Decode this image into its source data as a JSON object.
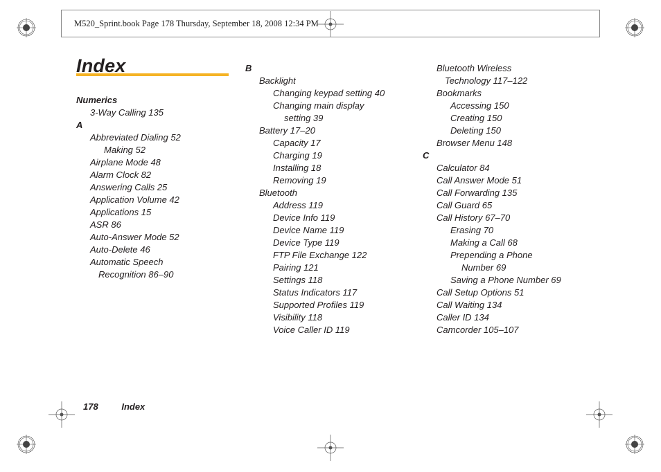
{
  "crop_header": "M520_Sprint.book  Page 178  Thursday, September 18, 2008  12:34 PM",
  "title": "Index",
  "footer": {
    "page": "178",
    "label": "Index"
  },
  "c1": {
    "hNumerics": "Numerics",
    "e3way": "3-Way Calling 135",
    "hA": "A",
    "abbrev": "Abbreviated Dialing 52",
    "abbrevMaking": "Making 52",
    "airplane": "Airplane Mode 48",
    "alarm": "Alarm Clock 82",
    "answering": "Answering Calls 25",
    "appvol": "Application Volume 42",
    "apps": "Applications 15",
    "asr": "ASR 86",
    "autoans": "Auto-Answer Mode 52",
    "autodel": "Auto-Delete 46",
    "autospeech1": "Automatic Speech",
    "autospeech2": "Recognition 86–90"
  },
  "c2": {
    "hB": "B",
    "backlight": "Backlight",
    "blKeypad": "Changing keypad setting 40",
    "blMain1": "Changing main display",
    "blMain2": "setting 39",
    "battery": "Battery 17–20",
    "batCap": "Capacity 17",
    "batChg": "Charging 19",
    "batInst": "Installing 18",
    "batRem": "Removing 19",
    "bluetooth": "Bluetooth",
    "btAddr": "Address 119",
    "btDevInfo": "Device Info 119",
    "btDevName": "Device Name 119",
    "btDevType": "Device Type 119",
    "btFtp": "FTP File Exchange 122",
    "btPair": "Pairing 121",
    "btSet": "Settings 118",
    "btStat": "Status Indicators 117",
    "btSup": "Supported Profiles 119",
    "btVis": "Visibility 118",
    "btVcid": "Voice Caller ID 119"
  },
  "c3": {
    "btw1": "Bluetooth Wireless",
    "btw2": "Technology 117–122",
    "bookmarks": "Bookmarks",
    "bmAccess": "Accessing 150",
    "bmCreate": "Creating 150",
    "bmDelete": "Deleting 150",
    "browser": "Browser Menu 148",
    "hC": "C",
    "calc": "Calculator 84",
    "callAns": "Call Answer Mode 51",
    "callFwd": "Call Forwarding 135",
    "callGuard": "Call Guard 65",
    "callHist": "Call History 67–70",
    "chErase": "Erasing 70",
    "chMake": "Making a Call 68",
    "chPre1": "Prepending a Phone",
    "chPre2": "Number 69",
    "chSave": "Saving a Phone Number 69",
    "callSetup": "Call Setup Options 51",
    "callWait": "Call Waiting 134",
    "callerID": "Caller ID 134",
    "camcorder": "Camcorder 105–107"
  }
}
